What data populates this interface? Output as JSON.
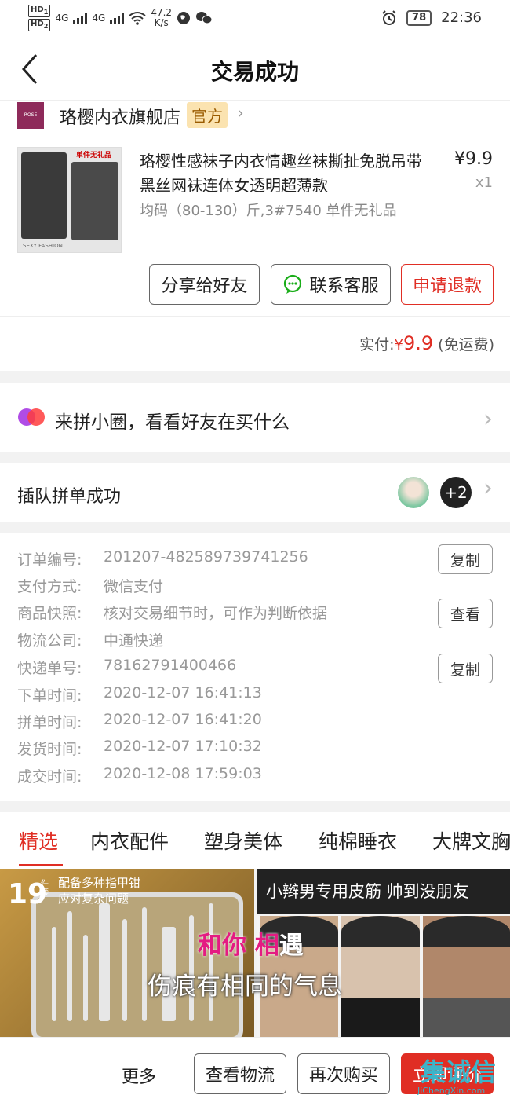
{
  "status_bar": {
    "hd1": "HD",
    "hd1_sub": "1",
    "hd2": "HD",
    "hd2_sub": "2",
    "net1": "4G",
    "net2": "4G",
    "speed": "47.2",
    "speed_unit": "K/s",
    "battery": "78",
    "time": "22:36"
  },
  "nav": {
    "title": "交易成功"
  },
  "shop": {
    "name": "珞樱内衣旗舰店",
    "badge": "官方",
    "logo_text": "ROSE SAKURA"
  },
  "product": {
    "image_tag": "单件无礼品",
    "image_brand": "SEXY FASHION",
    "title": "珞樱性感袜子内衣情趣丝袜撕扯免脱吊带黑丝网袜连体女透明超薄款",
    "spec": "均码（80-130）斤,3#7540 单件无礼品",
    "price": "¥9.9",
    "qty": "x1"
  },
  "actions": {
    "share": "分享给好友",
    "contact": "联系客服",
    "refund": "申请退款"
  },
  "payment": {
    "label": "实付:",
    "currency": "¥",
    "amount": "9.9",
    "note": "(免运费)"
  },
  "circle": {
    "text": "来拼小圈，看看好友在买什么"
  },
  "group": {
    "text": "插队拼单成功",
    "more_count": "+2"
  },
  "details": {
    "rows": [
      {
        "label": "订单编号:",
        "value": "201207-482589739741256"
      },
      {
        "label": "支付方式:",
        "value": "微信支付"
      },
      {
        "label": "商品快照:",
        "value": "核对交易细节时，可作为判断依据"
      },
      {
        "label": "物流公司:",
        "value": "中通快递"
      },
      {
        "label": "快递单号:",
        "value": "78162791400466"
      },
      {
        "label": "下单时间:",
        "value": "2020-12-07 16:41:13"
      },
      {
        "label": "拼单时间:",
        "value": "2020-12-07 16:41:20"
      },
      {
        "label": "发货时间:",
        "value": "2020-12-07 17:10:32"
      },
      {
        "label": "成交时间:",
        "value": "2020-12-08 17:59:03"
      }
    ],
    "copy_label": "复制",
    "view_label": "查看"
  },
  "tabs": [
    "精选",
    "内衣配件",
    "塑身美体",
    "纯棉睡衣",
    "大牌文胸"
  ],
  "banners": {
    "left": {
      "count": "19",
      "count_unit": "件套",
      "line1": "配备多种指甲钳",
      "line2": "应对复杂问题"
    },
    "right": {
      "headline": "小辫男专用皮筋 帅到没朋友"
    }
  },
  "lyrics": {
    "line1_a": "和你",
    "line1_b": " 相",
    "line1_c": "遇",
    "line2": "伤痕有相同的气息"
  },
  "bottom_bar": {
    "more": "更多",
    "logistics": "查看物流",
    "rebuy": "再次购买",
    "review": "立即评价"
  },
  "watermark": {
    "logo": "集诚信",
    "url": "JiChengXin.com"
  },
  "colors": {
    "accent": "#e02e24",
    "badge_bg": "#fbe3b0"
  }
}
